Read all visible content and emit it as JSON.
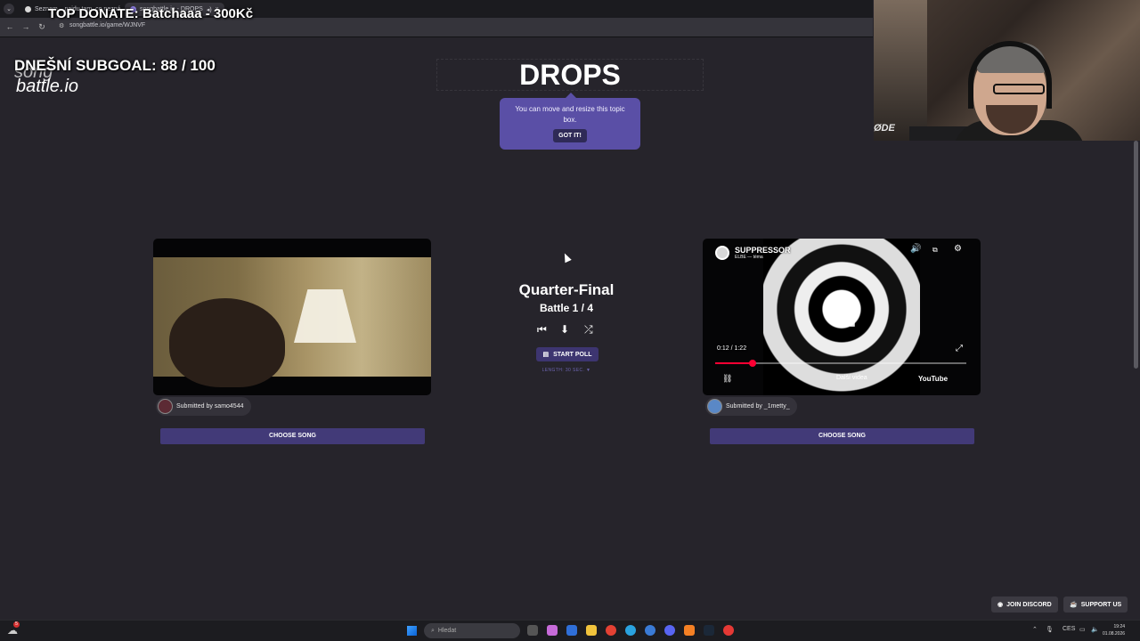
{
  "browser": {
    "tabs": [
      {
        "label": "Seznam – najdu tam, co nezná"
      },
      {
        "label": "songbattle.io - DROPS"
      }
    ],
    "url": "songbattle.io/game/WJNVF"
  },
  "overlay": {
    "top_donate": "TOP DONATE: Batchaaa - 300Kč",
    "subgoal": "DNEŠNÍ SUBGOAL:  88 / 100"
  },
  "logo": {
    "line1": "song",
    "line2": "battle.io"
  },
  "topic": {
    "title": "DROPS",
    "tooltip_text": "You can move and resize this topic box.",
    "got_it_label": "GOT IT!"
  },
  "left_song": {
    "submitted_by": "Submitted by samo4544",
    "choose_label": "CHOOSE SONG"
  },
  "right_song": {
    "youtube_title": "SUPPRESSOR",
    "youtube_channel": "ELBE — téma",
    "time": "0:12 / 1:22",
    "progress": 0.15,
    "more_videos": "Další videa",
    "youtube_brand": "YouTube",
    "submitted_by": "Submitted by _1metty_",
    "choose_label": "CHOOSE SONG"
  },
  "battle": {
    "round": "Quarter-Final",
    "battle_counter": "Battle 1 / 4",
    "start_poll_label": "START POLL",
    "length_label": "LENGTH: 30 SEC. ▼"
  },
  "webcam": {
    "label": "ØDE"
  },
  "footer": {
    "join_discord": "JOIN DISCORD",
    "support_us": "SUPPORT US"
  },
  "taskbar": {
    "search_placeholder": "Hledat",
    "notification_count": "5",
    "language": "CES",
    "time": "19:24",
    "date": "01.08.2026"
  },
  "colors": {
    "background": "#26242b",
    "accent": "#5a4fa6",
    "button": "#423a78"
  }
}
